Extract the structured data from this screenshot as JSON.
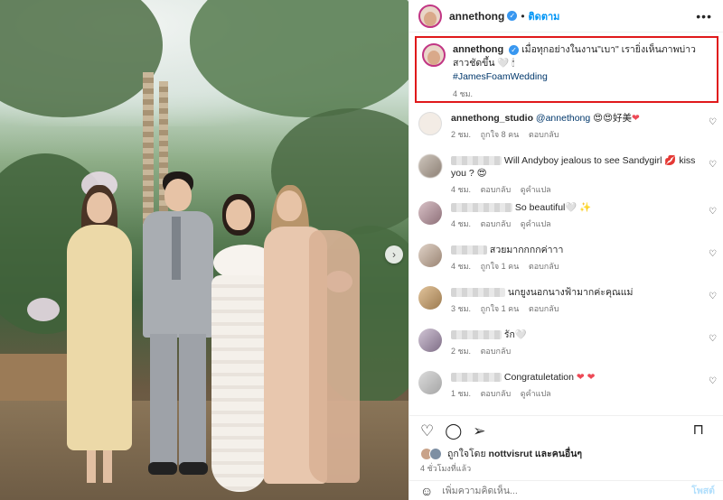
{
  "post": {
    "username": "annethong",
    "follow_label": "ติดตาม",
    "more_label": "•••",
    "caption": {
      "text": "เมื่อทุกอย่างในงาน\"เบา\" เรายิ่งเห็นภาพบ่าวสาวชัดขึ้น 🤍 🕯",
      "hashtag": "#JamesFoamWedding",
      "time": "4 ชม."
    }
  },
  "comments": [
    {
      "user": "annethong_studio",
      "mention": "@annethong",
      "text": " 😍😍好美",
      "heart": "❤",
      "time": "2 ชม.",
      "likes": "ถูกใจ 8 คน",
      "reply": "ตอบกลับ",
      "translate": ""
    },
    {
      "user": "",
      "mention": "",
      "text": "Will Andyboy jealous to see Sandygirl 💋 kiss you ? 😍",
      "heart": "",
      "time": "4 ชม.",
      "likes": "",
      "reply": "ตอบกลับ",
      "translate": "ดูคำแปล"
    },
    {
      "user": "",
      "mention": "",
      "text": "So beautiful🤍 ✨",
      "heart": "",
      "time": "4 ชม.",
      "likes": "",
      "reply": "ตอบกลับ",
      "translate": "ดูคำแปล"
    },
    {
      "user": "",
      "mention": "",
      "text": "สวยมากกกกค่าาา",
      "heart": "",
      "time": "4 ชม.",
      "likes": "ถูกใจ 1 คน",
      "reply": "ตอบกลับ",
      "translate": ""
    },
    {
      "user": "",
      "mention": "",
      "text": "นกยูงนอกนางฟ้ามากค่ะคุณแม่",
      "heart": "",
      "time": "3 ชม.",
      "likes": "ถูกใจ 1 คน",
      "reply": "ตอบกลับ",
      "translate": ""
    },
    {
      "user": "",
      "mention": "",
      "text": "รัก🤍",
      "heart": "",
      "time": "2 ชม.",
      "likes": "",
      "reply": "ตอบกลับ",
      "translate": ""
    },
    {
      "user": "",
      "mention": "",
      "text": "Congratuletation",
      "heart": "❤ ❤",
      "time": "1 ชม.",
      "likes": "",
      "reply": "ตอบกลับ",
      "translate": "ดูคำแปล"
    }
  ],
  "actions": {
    "like_icon": "heart-outline-icon",
    "comment_icon": "comment-icon",
    "share_icon": "share-icon",
    "save_icon": "bookmark-icon"
  },
  "likes_line": {
    "prefix": "ถูกใจโดย",
    "user": "nottvisrut",
    "suffix": "และคนอื่นๆ"
  },
  "time_ago": "4 ชั่วโมงที่แล้ว",
  "add_comment": {
    "placeholder": "เพิ่มความคิดเห็น...",
    "post_label": "โพสต์"
  },
  "colors": {
    "accent": "#0095f6",
    "highlight_border": "#e0191b",
    "heart": "#ed4956"
  }
}
